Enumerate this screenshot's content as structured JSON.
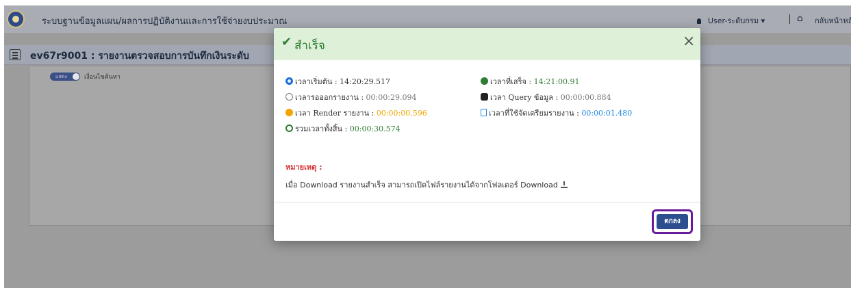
{
  "app": {
    "title": "ระบบฐานข้อมูลแผน/ผลการปฏิบัติงานและการใช้จ่ายงบประมาณ",
    "user_label": "User-ระดับกรม",
    "user_caret": "▾",
    "home_label": "กลับหน้าหลัก"
  },
  "report": {
    "title": "ev67r9001 : รายงานตรวจสอบการบันทึกเงินระดับ"
  },
  "filter": {
    "toggle_label": "แสดง",
    "toggle_caption": "เงื่อนไขค้นหา"
  },
  "modal": {
    "title": "สำเร็จ",
    "close_symbol": "×",
    "start_time_label": "เวลาเริ่มต้น :",
    "start_time_value": "14:20:29.517",
    "end_time_label": "เวลาที่เสร็จ :",
    "end_time_value": "14:21:00.91",
    "output_time_label": "เวลารอออกรายงาน :",
    "output_time_value": "00:00:29.094",
    "query_time_label": "เวลา Query ข้อมูล :",
    "query_time_value": "00:00:00.884",
    "render_time_label": "เวลา Render รายงาน :",
    "render_time_value": "00:00:00.596",
    "prepare_time_label": "เวลาที่ใช้จัดเตรียมรายงาน :",
    "prepare_time_value": "00:00:01.480",
    "total_time_label": "รวมเวลาทั้งสิ้น :",
    "total_time_value": "00:00:30.574",
    "note_label": "หมายเหตุ :",
    "note_text": "เมื่อ Download รายงานสำเร็จ สามารถเปิดไฟล์รายงานได้จากโฟลเดอร์ Download",
    "ok_label": "ตกลง"
  },
  "colors": {
    "success_header": "#dff0d8",
    "success_text": "#2e7d32",
    "ok_button": "#2e4f8f",
    "ok_highlight": "#6a1b9a",
    "note_red": "#d32f2f"
  }
}
